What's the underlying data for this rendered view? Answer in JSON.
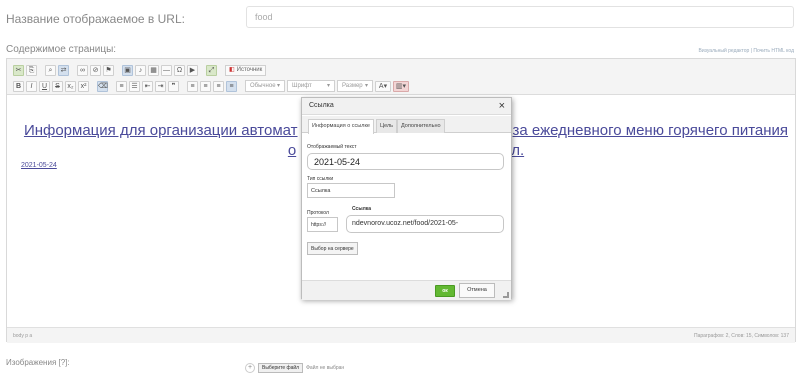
{
  "url_row": {
    "label": "Название отображаемое в URL:",
    "value": "food"
  },
  "content": {
    "label": "Содержимое страницы:",
    "visual_links": "Визуальный редактор | Почить HTML код"
  },
  "toolbar": {
    "source_label": "Источник",
    "format_combo": "Обычное",
    "font_combo": "Шрифт",
    "size_combo": "Размер"
  },
  "document": {
    "heading": "Информация для организации автомат... за ежедневного меню горячего питания о...",
    "heading_left": "Информация для организации автомат",
    "heading_right": "за ежедневного меню горячего питания",
    "heading_line2_left": "о",
    "heading_line2_right": "л.",
    "date_link": "2021-05-24"
  },
  "statusbar": {
    "path": "body p a",
    "counts": "Параграфов: 2, Слов: 15, Символов: 137"
  },
  "images": {
    "label": "Изображения [?]:",
    "choose_file": "Выберите файл",
    "no_file": "Файл не выбран"
  },
  "dialog": {
    "title": "Ссылка",
    "tabs": [
      "Информация о ссылке",
      "Цель",
      "Дополнительно"
    ],
    "display_text_label": "Отображаемый текст",
    "display_text_value": "2021-05-24",
    "link_type_label": "Тип ссылки",
    "link_type_value": "Ссылка",
    "protocol_label": "Протокол",
    "protocol_value": "https://",
    "url_label": "Ссылка",
    "url_value": "ndevnorov.ucoz.net/food/2021-05-",
    "server_button": "Выбор на сервере",
    "ok": "ок",
    "cancel": "Отмена"
  },
  "colors": {
    "ok_green": "#62b832",
    "link_blue": "#4a4a9a"
  }
}
